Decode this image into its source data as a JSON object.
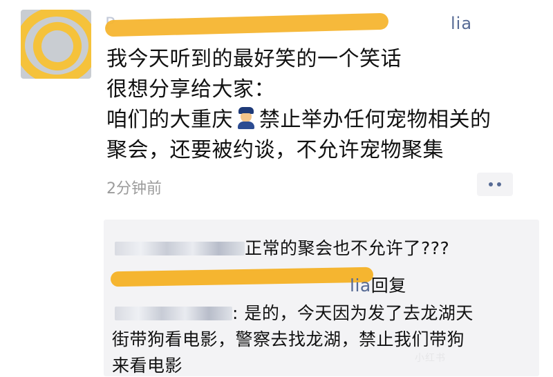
{
  "post": {
    "author_visible_suffix": "lia",
    "lines": [
      "我今天听到的最好笑的一个笑话",
      "很想分享给大家：",
      "咱们的大重庆",
      "禁止举办任何宠物相关的",
      "聚会，还要被约谈，不允许宠物聚集"
    ],
    "emoji_icon": "police-officer-icon",
    "time": "2分钟前"
  },
  "comments": [
    {
      "text": "正常的聚会也不允许了???"
    },
    {
      "author_suffix": "lia",
      "action": "回复"
    },
    {
      "line1": ": 是的，今天因为发了去龙湖天",
      "line2": "街带狗看电影，警察去找龙湖，禁止我们带狗",
      "line3": "来看电影"
    }
  ],
  "watermark": "小红书",
  "colors": {
    "highlight": "#f5b530",
    "link": "#576b95",
    "comment_bg": "#f3f3f5"
  }
}
